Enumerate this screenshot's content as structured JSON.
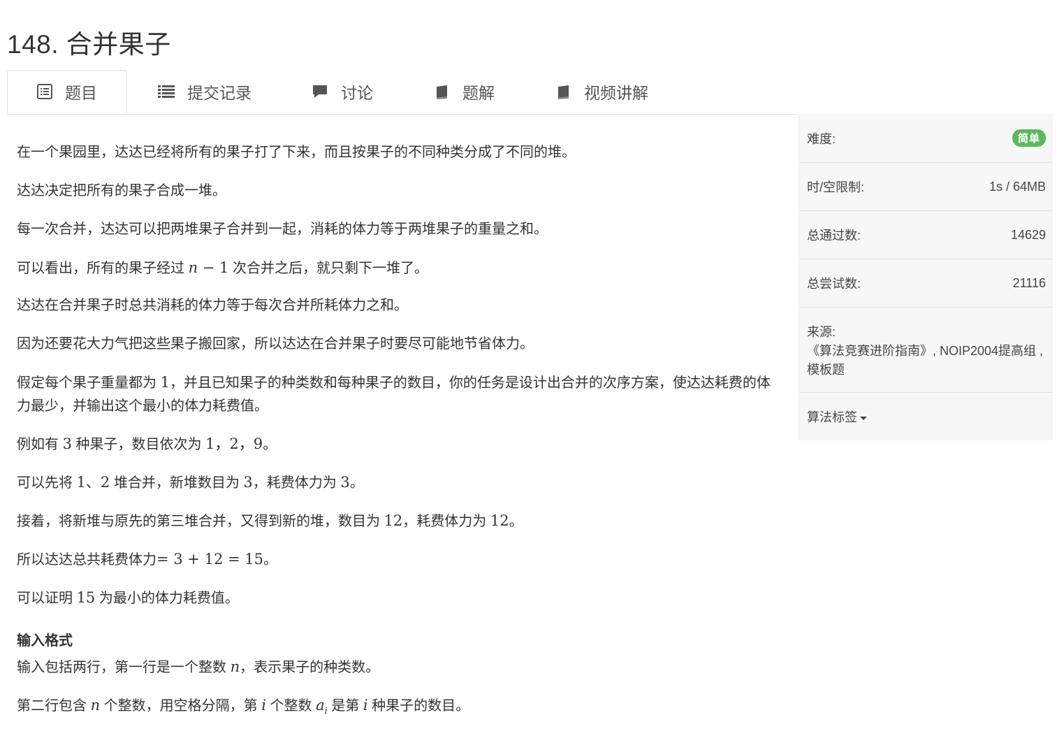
{
  "page": {
    "title": "148. 合并果子"
  },
  "tabs": [
    {
      "label": "题目",
      "icon": "list-alt-icon"
    },
    {
      "label": "提交记录",
      "icon": "list-icon"
    },
    {
      "label": "讨论",
      "icon": "comment-icon"
    },
    {
      "label": "题解",
      "icon": "book-icon"
    },
    {
      "label": "视频讲解",
      "icon": "book-icon"
    }
  ],
  "problem": {
    "p1": "在一个果园里，达达已经将所有的果子打了下来，而且按果子的不同种类分成了不同的堆。",
    "p2": "达达决定把所有的果子合成一堆。",
    "p3": "每一次合并，达达可以把两堆果子合并到一起，消耗的体力等于两堆果子的重量之和。",
    "p4": {
      "a": "可以看出，所有的果子经过 ",
      "var_n": "n",
      "op": " − 1",
      "b": " 次合并之后，就只剩下一堆了。"
    },
    "p5": "达达在合并果子时总共消耗的体力等于每次合并所耗体力之和。",
    "p6": "因为还要花大力气把这些果子搬回家，所以达达在合并果子时要尽可能地节省体力。",
    "p7": {
      "a": "假定每个果子重量都为 ",
      "m1": "1",
      "b": "，并且已知果子的种类数和每种果子的数目，你的任务是设计出合并的次序方案，使达达耗费的体力最少，并输出这个最小的体力耗费值。"
    },
    "p8": {
      "a": "例如有 ",
      "m1": "3",
      "b": " 种果子，数目依次为 ",
      "m2": "1，2，9",
      "c": "。"
    },
    "p9": {
      "a": "可以先将 ",
      "m1": "1、2",
      "b": " 堆合并，新堆数目为 ",
      "m2": "3",
      "c": "，耗费体力为 ",
      "m3": "3",
      "d": "。"
    },
    "p10": {
      "a": "接着，将新堆与原先的第三堆合并，又得到新的堆，数目为 ",
      "m1": "12",
      "b": "，耗费体力为 ",
      "m2": "12",
      "c": "。"
    },
    "p11": {
      "a": "所以达达总共耗费体力",
      "m1": "= 3 + 12 = 15",
      "b": "。"
    },
    "p12": {
      "a": "可以证明 ",
      "m1": "15",
      "b": " 为最小的体力耗费值。"
    },
    "input_heading": "输入格式",
    "in1": {
      "a": "输入包括两行，第一行是一个整数 ",
      "var_n": "n",
      "b": "，表示果子的种类数。"
    },
    "in2": {
      "a": "第二行包含 ",
      "var_n": "n",
      "b": " 个整数，用空格分隔，第 ",
      "var_i": "i",
      "c": " 个整数 ",
      "var_a": "a",
      "sub_i": "i",
      "d": " 是第 ",
      "var_i2": "i",
      "e": " 种果子的数目。"
    }
  },
  "panel": {
    "difficulty_label": "难度:",
    "difficulty_value": "简单",
    "limit_label": "时/空限制:",
    "limit_value": "1s / 64MB",
    "passed_label": "总通过数:",
    "passed_value": "14629",
    "tried_label": "总尝试数:",
    "tried_value": "21116",
    "source_label": "来源:",
    "source_value": "《算法竞赛进阶指南》, NOIP2004提高组 , 模板题",
    "tags_label": "算法标签"
  },
  "colors": {
    "badge_easy": "#5cb85c",
    "panel_bg": "#f7f7f7"
  }
}
